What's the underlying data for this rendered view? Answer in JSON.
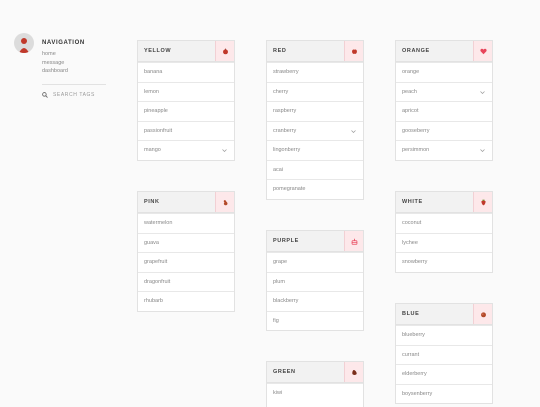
{
  "navigation": {
    "title": "NAVIGATION",
    "links": [
      "home",
      "message",
      "dashboard"
    ],
    "search_label": "SEARCH TAGS"
  },
  "colors": {
    "accent": "#e8445a",
    "icon_bg": "#fde8ea",
    "head_bg": "#f2f2f2"
  },
  "groups": {
    "yellow": {
      "title": "YELLOW",
      "icon": "grapefruit-icon",
      "items": [
        "banana",
        "lemon",
        "pineapple",
        "passionfruit",
        "mango"
      ]
    },
    "red": {
      "title": "RED",
      "icon": "apple-icon",
      "items": [
        "strawberry",
        "cherry",
        "raspberry",
        "cranberry",
        "lingonberry",
        "acai",
        "pomegranate"
      ]
    },
    "orange": {
      "title": "ORANGE",
      "icon": "heart-icon",
      "items": [
        "orange",
        "peach",
        "apricot",
        "gooseberry",
        "persimmon"
      ]
    },
    "pink": {
      "title": "PINK",
      "icon": "pear-icon",
      "items": [
        "watermelon",
        "guava",
        "grapefruit",
        "dragonfruit",
        "rhubarb"
      ]
    },
    "purple": {
      "title": "PURPLE",
      "icon": "cake-icon",
      "items": [
        "grape",
        "plum",
        "blackberry",
        "fig"
      ]
    },
    "white": {
      "title": "WHITE",
      "icon": "strawberry-icon",
      "items": [
        "coconut",
        "lychee",
        "snowberry"
      ]
    },
    "blue": {
      "title": "BLUE",
      "icon": "berry-icon",
      "items": [
        "blueberry",
        "currant",
        "elderberry",
        "boysenberry"
      ]
    },
    "green": {
      "title": "GREEN",
      "icon": "avocado-icon",
      "items": [
        "kiwi"
      ]
    }
  }
}
